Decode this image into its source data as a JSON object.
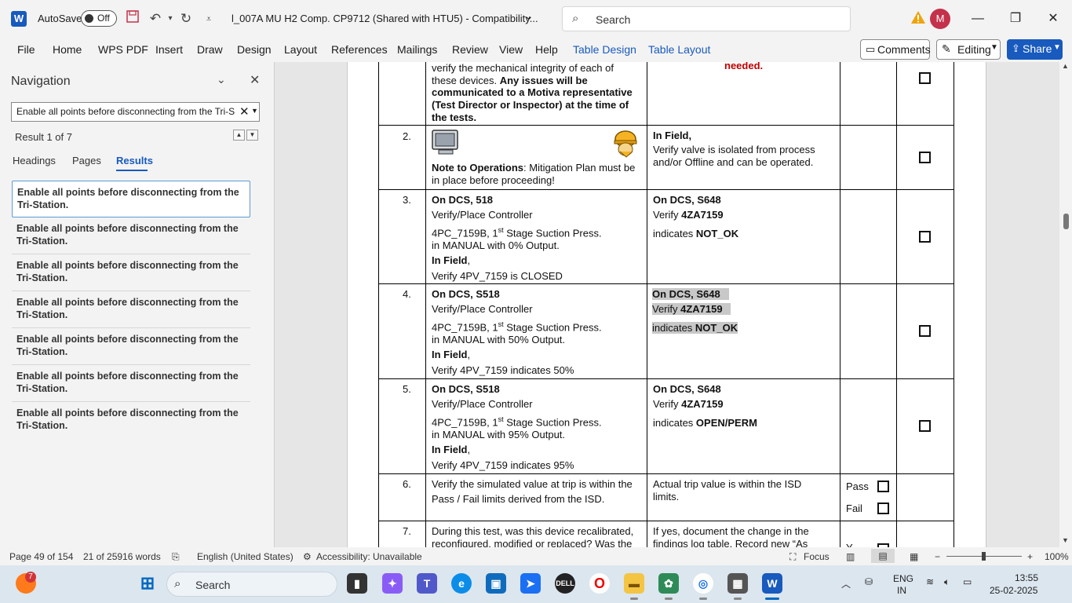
{
  "titlebar": {
    "app_icon": "word-icon",
    "autosave_label": "AutoSave",
    "autosave_state": "Off",
    "doc_title": "l_007A MU H2 Comp. CP9712 (Shared with HTU5)  -  Compatibility...",
    "search_placeholder": "Search",
    "avatar_initial": "M"
  },
  "ribbon": {
    "tabs": [
      "File",
      "Home",
      "WPS PDF",
      "Insert",
      "Draw",
      "Design",
      "Layout",
      "References",
      "Mailings",
      "Review",
      "View",
      "Help",
      "Table Design",
      "Table Layout"
    ],
    "contextual_tab_color": "#185abd",
    "comments_label": "Comments",
    "editing_label": "Editing",
    "share_label": "Share"
  },
  "navigation": {
    "title": "Navigation",
    "search_value": "Enable all points before disconnecting from the Tri-S",
    "result_text": "Result 1 of 7",
    "tabs": [
      "Headings",
      "Pages",
      "Results"
    ],
    "active_tab": "Results",
    "results": [
      "Enable all points before disconnecting from the Tri-Station.",
      "Enable all points before disconnecting from the Tri-Station.",
      "Enable all points before disconnecting from the Tri-Station.",
      "Enable all points before disconnecting from the Tri-Station.",
      "Enable all points before disconnecting from the Tri-Station.",
      "Enable all points before disconnecting from the Tri-Station.",
      "Enable all points before disconnecting from the Tri-Station."
    ]
  },
  "document": {
    "row1": {
      "l1": "verify the mechanical integrity of each of",
      "l2a": "these devices. ",
      "l2b": "Any issues will be",
      "l3": "communicated to a Motiva representative",
      "l4": "(Test Director or Inspector) at the time of",
      "l5": "the tests.",
      "right": "needed."
    },
    "row2": {
      "num": "2.",
      "note_bold": "Note to Operations",
      "note_rest": ": Mitigation Plan must be",
      "note_l2": "in place before proceeding!",
      "r1": "In Field,",
      "r2": "Verify valve is isolated from process",
      "r3": "and/or Offline and can be operated."
    },
    "row3": {
      "num": "3.",
      "l1a": "On DCS",
      "l1b": ", 518",
      "l2": "Verify/Place Controller",
      "l3a": "4PC_7159B, 1",
      "l3sup": "st",
      "l3b": " Stage Suction Press.",
      "l4": " in MANUAL with 0% Output.",
      "l5a": "In Field",
      "l5b": ",",
      "l6": "Verify 4PV_7159 is CLOSED",
      "r1a": "On DCS",
      "r1b": ", S648",
      "r2a": "Verify ",
      "r2b": "4ZA7159",
      "r3a": " indicates ",
      "r3b": "NOT_OK"
    },
    "row4": {
      "num": "4.",
      "l1a": "On DCS",
      "l1b": ", S518",
      "l2": "Verify/Place Controller",
      "l3a": "4PC_7159B, 1",
      "l3sup": "st",
      "l3b": " Stage Suction Press.",
      "l4": " in MANUAL with 50% Output.",
      "l5a": "In Field",
      "l5b": ",",
      "l6": "Verify 4PV_7159 indicates 50%",
      "r1a": "On DCS",
      "r1b": ", S648",
      "r2a": "Verify ",
      "r2b": "4ZA7159",
      "r3a": " indicates ",
      "r3b": "NOT_OK"
    },
    "row5": {
      "num": "5.",
      "l1a": "On DCS",
      "l1b": ", S518",
      "l2": "Verify/Place Controller",
      "l3a": "4PC_7159B, 1",
      "l3sup": "st",
      "l3b": " Stage Suction Press.",
      "l4": " in MANUAL with 95% Output.",
      "l5a": "In Field",
      "l5b": ",",
      "l6": "Verify 4PV_7159 indicates 95%",
      "r1a": "On DCS",
      "r1b": ", S648",
      "r2a": "Verify ",
      "r2b": "4ZA7159",
      "r3a": " indicates ",
      "r3b": "OPEN/PERM"
    },
    "row6": {
      "num": "6.",
      "l1": "Verify the simulated value at trip is within the",
      "l2": "Pass / Fail limits derived from the ISD.",
      "r1": "Actual trip value is within the ISD",
      "r2": "limits.",
      "pass": "Pass",
      "fail": "Fail"
    },
    "row7": {
      "num": "7.",
      "l1": "During this test, was this device recalibrated,",
      "l2": "reconfigured, modified or replaced? Was the",
      "r1": "If yes, document the change in the",
      "r2": "findings log table. Record new “As",
      "yes_partial": "Y"
    }
  },
  "statusbar": {
    "page": "Page 49 of 154",
    "words": "21 of 25916 words",
    "language": "English (United States)",
    "accessibility": "Accessibility: Unavailable",
    "focus": "Focus",
    "zoom": "100%"
  },
  "taskbar": {
    "search_placeholder": "Search",
    "notification_count": "7",
    "lang_line1": "ENG",
    "lang_line2": "IN",
    "time": "13:55",
    "date": "25-02-2025"
  }
}
